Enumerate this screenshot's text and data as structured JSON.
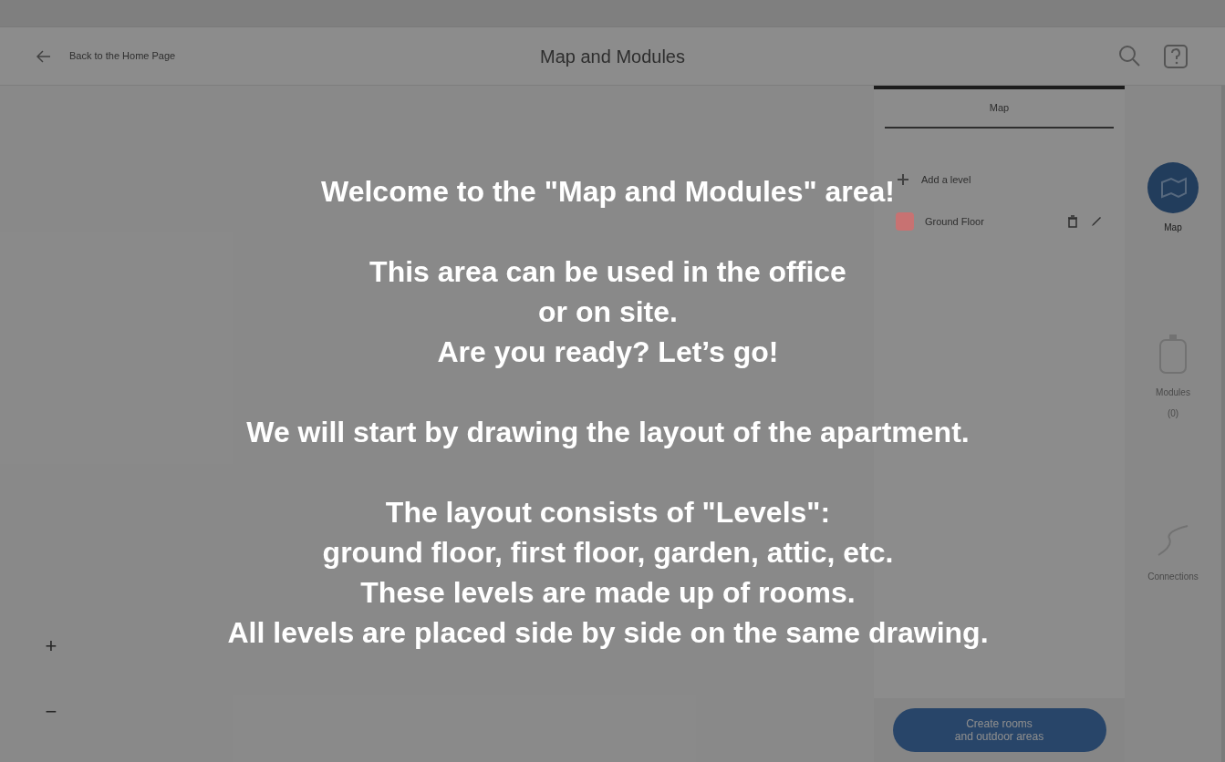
{
  "header": {
    "back_label": "Back to the Home Page",
    "title": "Map and Modules"
  },
  "panel": {
    "tab": {
      "label": "Map",
      "selected": true
    },
    "add_level": "Add a level",
    "levels": [
      {
        "name": "Ground Floor",
        "color": "#c87272"
      }
    ],
    "create_button": "Create rooms\nand outdoor areas"
  },
  "sidebar": {
    "items": [
      {
        "kind": "map",
        "label": "Map",
        "selected": true
      },
      {
        "kind": "modules",
        "label": "Modules",
        "count": "(0)",
        "selected": false
      },
      {
        "kind": "connections",
        "label": "Connections",
        "selected": false
      }
    ]
  },
  "zoom_controls": [
    "+",
    "−"
  ],
  "overlay": {
    "paragraphs": [
      [
        "Welcome to the \"Map and Modules\" area!"
      ],
      [
        "This area can be used in the office",
        "or on site.",
        "Are you ready? Let’s go!"
      ],
      [
        "We will start by drawing the layout of the apartment."
      ],
      [
        "The layout consists of \"Levels\":",
        "ground floor, first floor, garden, attic, etc.",
        "These levels are made up of rooms.",
        "All levels are placed side by side on the same drawing."
      ]
    ]
  }
}
